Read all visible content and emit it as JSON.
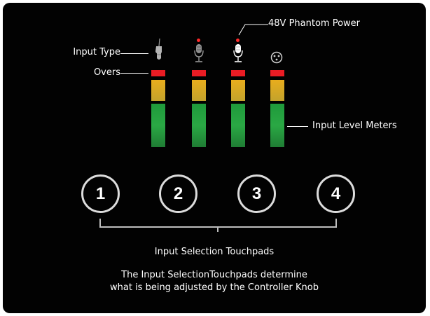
{
  "labels": {
    "input_type": "Input Type",
    "overs": "Overs",
    "phantom_power": "48V Phantom Power",
    "input_level_meters": "Input Level Meters"
  },
  "pads": [
    {
      "number": "1"
    },
    {
      "number": "2"
    },
    {
      "number": "3"
    },
    {
      "number": "4"
    }
  ],
  "channels": [
    {
      "input_icon": "guitar-plug-icon",
      "phantom_led": false
    },
    {
      "input_icon": "microphone-icon",
      "phantom_led": true
    },
    {
      "input_icon": "microphone-icon",
      "phantom_led": true,
      "highlighted": true
    },
    {
      "input_icon": "xlr-connector-icon",
      "phantom_led": false
    }
  ],
  "captions": {
    "title": "Input Selection Touchpads",
    "description_line1": "The Input SelectionTouchpads determine",
    "description_line2": "what is being adjusted by the Controller Knob"
  },
  "colors": {
    "background": "#020202",
    "overs": "#ea1c24",
    "meter_yellow": "#e9ad1d",
    "meter_green": "#2aa844",
    "phantom_led": "#ff2a2a"
  }
}
